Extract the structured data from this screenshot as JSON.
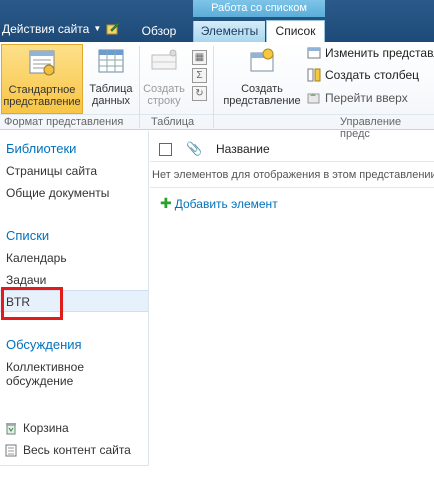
{
  "topbar": {
    "site_actions": "Действия сайта",
    "context_group": "Работа со списком",
    "tabs": [
      "Обзор",
      "Элементы",
      "Список"
    ]
  },
  "ribbon": {
    "std_view": "Стандартное представление",
    "table": "Таблица данных",
    "create_row": "Создать строку",
    "create_view": "Создать представление",
    "modify_view": "Изменить представл",
    "create_column": "Создать столбец",
    "navigate_up": "Перейти вверх",
    "group_labels": [
      "Формат представления",
      "Таблица",
      "Управление предс"
    ]
  },
  "leftnav": {
    "libraries": "Библиотеки",
    "lib_items": [
      "Страницы сайта",
      "Общие документы"
    ],
    "lists": "Списки",
    "list_items": [
      "Календарь",
      "Задачи",
      "BTR"
    ],
    "discussions": "Обсуждения",
    "disc_items": [
      "Коллективное",
      "обсуждение"
    ],
    "recycle": "Корзина",
    "all_content": "Весь контент сайта"
  },
  "main": {
    "column_name": "Название",
    "empty_text": "Нет элементов для отображения в этом представлении",
    "add_item": "Добавить элемент"
  }
}
